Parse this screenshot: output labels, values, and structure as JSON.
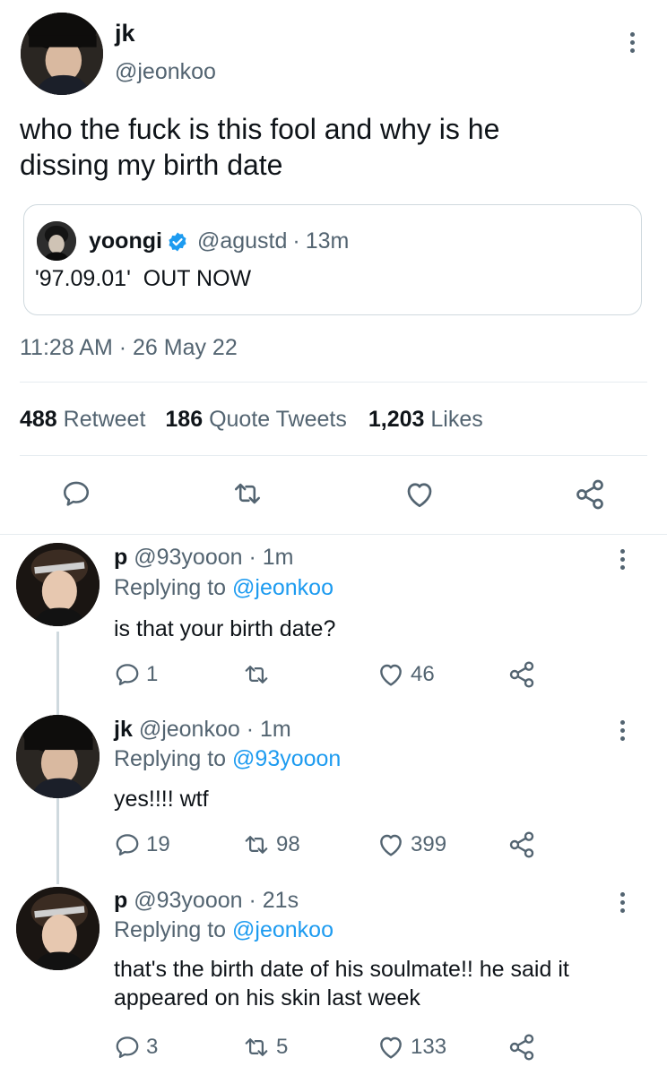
{
  "main_tweet": {
    "display_name": "jk",
    "handle": "@jeonkoo",
    "text_line1": "who the fuck is this fool and why is he",
    "text_line2": "dissing my birth date",
    "quoted": {
      "display_name": "yoongi",
      "handle": "@agustd",
      "separator": "·",
      "time": "13m",
      "text": "'97.09.01'  OUT NOW",
      "verified_icon": "verified-badge-icon"
    },
    "timestamp": "11:28 AM · 26 May 22",
    "stats": {
      "retweets_count": "488",
      "retweets_label": "Retweet",
      "quotes_count": "186",
      "quotes_label": "Quote Tweets",
      "likes_count": "1,203",
      "likes_label": "Likes"
    },
    "actions": [
      "reply-icon",
      "retweet-icon",
      "like-icon",
      "share-icon"
    ]
  },
  "replies": [
    {
      "display_name": "p",
      "handle": "@93yooon",
      "time": "· 1m",
      "replying_label": "Replying to",
      "replying_to": "@jeonkoo",
      "text_line1": "is that your birth date?",
      "text_line2": "",
      "reply_count": "1",
      "retweet_count": "",
      "like_count": "46"
    },
    {
      "display_name": "jk",
      "handle": "@jeonkoo",
      "time": "· 1m",
      "replying_label": "Replying to",
      "replying_to": "@93yooon",
      "text_line1": "yes!!!! wtf",
      "text_line2": "",
      "reply_count": "19",
      "retweet_count": "98",
      "like_count": "399"
    },
    {
      "display_name": "p",
      "handle": "@93yooon",
      "time": "· 21s",
      "replying_label": "Replying to",
      "replying_to": "@jeonkoo",
      "text_line1": "that's the birth date of his soulmate!! he said it",
      "text_line2": "appeared on his skin last week",
      "reply_count": "3",
      "retweet_count": "5",
      "like_count": "133"
    }
  ],
  "colors": {
    "accent": "#1d9bf0",
    "text": "#0f1419",
    "secondary": "#536471",
    "divider": "#e6ecf0"
  }
}
